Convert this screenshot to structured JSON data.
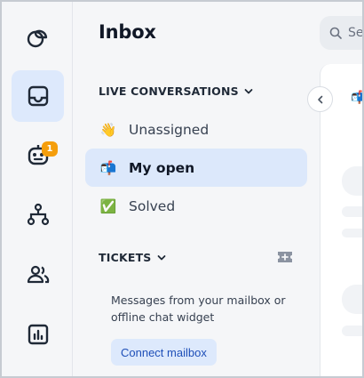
{
  "sidebar_rail": {
    "items": [
      {
        "name": "conversations-logo-icon",
        "active": false
      },
      {
        "name": "inbox-tray-icon",
        "active": true
      },
      {
        "name": "bot-icon",
        "active": false,
        "badge": "1"
      },
      {
        "name": "hierarchy-icon",
        "active": false
      },
      {
        "name": "contacts-icon",
        "active": false
      },
      {
        "name": "reports-chart-icon",
        "active": false
      }
    ]
  },
  "panel": {
    "title": "Inbox",
    "live_section": {
      "label": "LIVE CONVERSATIONS",
      "items": [
        {
          "emoji": "👋",
          "label": "Unassigned",
          "active": false
        },
        {
          "emoji": "📬",
          "label": "My open",
          "active": true
        },
        {
          "emoji": "✅",
          "label": "Solved",
          "active": false
        }
      ]
    },
    "tickets_section": {
      "label": "TICKETS",
      "description": "Messages from your mailbox or offline chat widget",
      "connect_label": "Connect mailbox"
    }
  },
  "search": {
    "placeholder": "Se"
  },
  "colors": {
    "accent": "#1e4fb8",
    "active_bg": "#dce8fb",
    "badge": "#f59e0b"
  }
}
